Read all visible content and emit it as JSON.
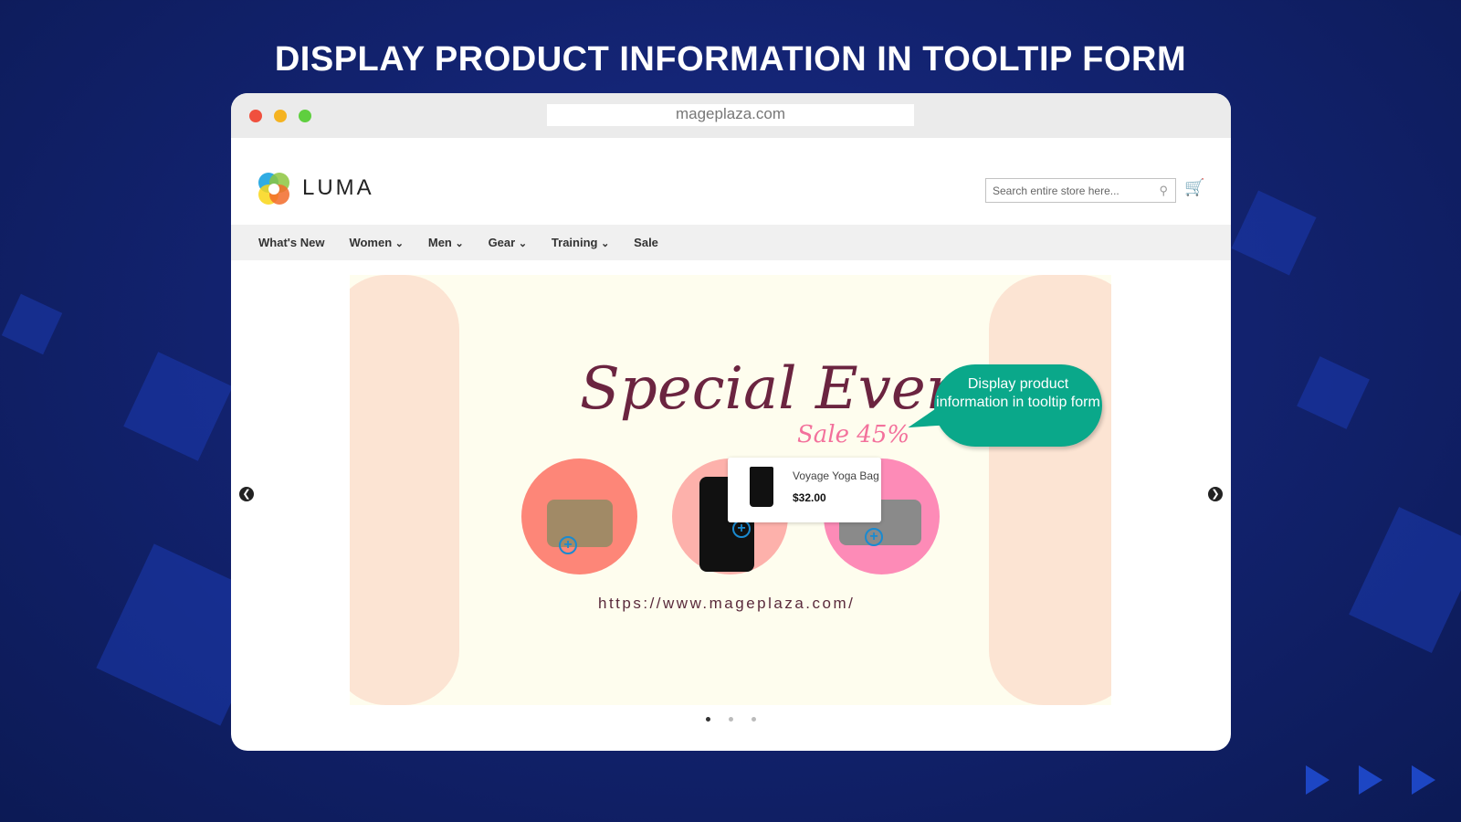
{
  "headline": "DISPLAY PRODUCT INFORMATION IN TOOLTIP FORM",
  "browser": {
    "url": "mageplaza.com",
    "dots": [
      "#f0503e",
      "#f5b321",
      "#5fcf3f"
    ]
  },
  "store": {
    "brand": "LUMA",
    "search_placeholder": "Search entire store here...",
    "nav": [
      "What's New",
      "Women",
      "Men",
      "Gear",
      "Training",
      "Sale"
    ],
    "nav_has_dropdown": [
      false,
      true,
      true,
      true,
      true,
      false
    ]
  },
  "banner": {
    "title": "Special Event",
    "subtitle": "Sale 45%",
    "url": "https://www.mageplaza.com/",
    "callout": "Display product information in tooltip form",
    "tooltip": {
      "name": "Voyage Yoga Bag",
      "price": "$32.00"
    },
    "circle_colors": [
      "#fd8678",
      "#fdb1ab",
      "#fd8bb7"
    ],
    "active_slide": 1,
    "slides": 3
  }
}
